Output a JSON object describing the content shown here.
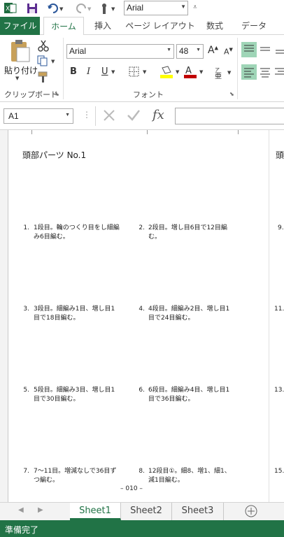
{
  "qat": {
    "font_value": "Arial"
  },
  "tabs": [
    "ファイル",
    "ホーム",
    "挿入",
    "ページ レイアウト",
    "数式",
    "データ"
  ],
  "ribbon": {
    "paste_label": "貼り付け",
    "font_name": "Arial",
    "font_size": "48",
    "grow_label": "A",
    "shrink_label": "A",
    "bold": "B",
    "italic": "I",
    "underline": "U",
    "font_color_label": "A",
    "clipboard_group": "クリップボード",
    "font_group": "フォント"
  },
  "formula_bar": {
    "name_box": "A1",
    "fx": "fx"
  },
  "sheet": {
    "title": "頭部パーツ No.1",
    "title_right": "頭",
    "items": [
      {
        "num": "1.",
        "text": [
          "1段目。輪のつくり目をし細編",
          "み6目編む。"
        ]
      },
      {
        "num": "2.",
        "text": [
          "2段目。増し目6目で12目編",
          "む。"
        ]
      },
      {
        "num": "3.",
        "text": [
          "3段目。細編み1目、増し目1",
          "目で18目編む。"
        ]
      },
      {
        "num": "4.",
        "text": [
          "4段目。細編み2目、増し目1",
          "目で24目編む。"
        ]
      },
      {
        "num": "5.",
        "text": [
          "5段目。細編み3目、増し目1",
          "目で30目編む。"
        ]
      },
      {
        "num": "6.",
        "text": [
          "6段目。細編み4目、増し目1",
          "目で36目編む。"
        ]
      },
      {
        "num": "7.",
        "text": [
          "7〜11目。増減なしで36目ず",
          "つ編む。"
        ]
      },
      {
        "num": "8.",
        "text": [
          "12段目①。細8、増1、細1、",
          "減1目編む。"
        ]
      }
    ],
    "right_nums": [
      "9.",
      "11.",
      "13.",
      "15."
    ],
    "footer": "– 010 –"
  },
  "sheet_tabs": [
    "Sheet1",
    "Sheet2",
    "Sheet3"
  ],
  "status": "準備完了",
  "colors": {
    "excel_green": "#217346",
    "highlight_yellow": "#ffff00",
    "font_red": "#c00000",
    "font_blue": "#1f4e9b"
  }
}
